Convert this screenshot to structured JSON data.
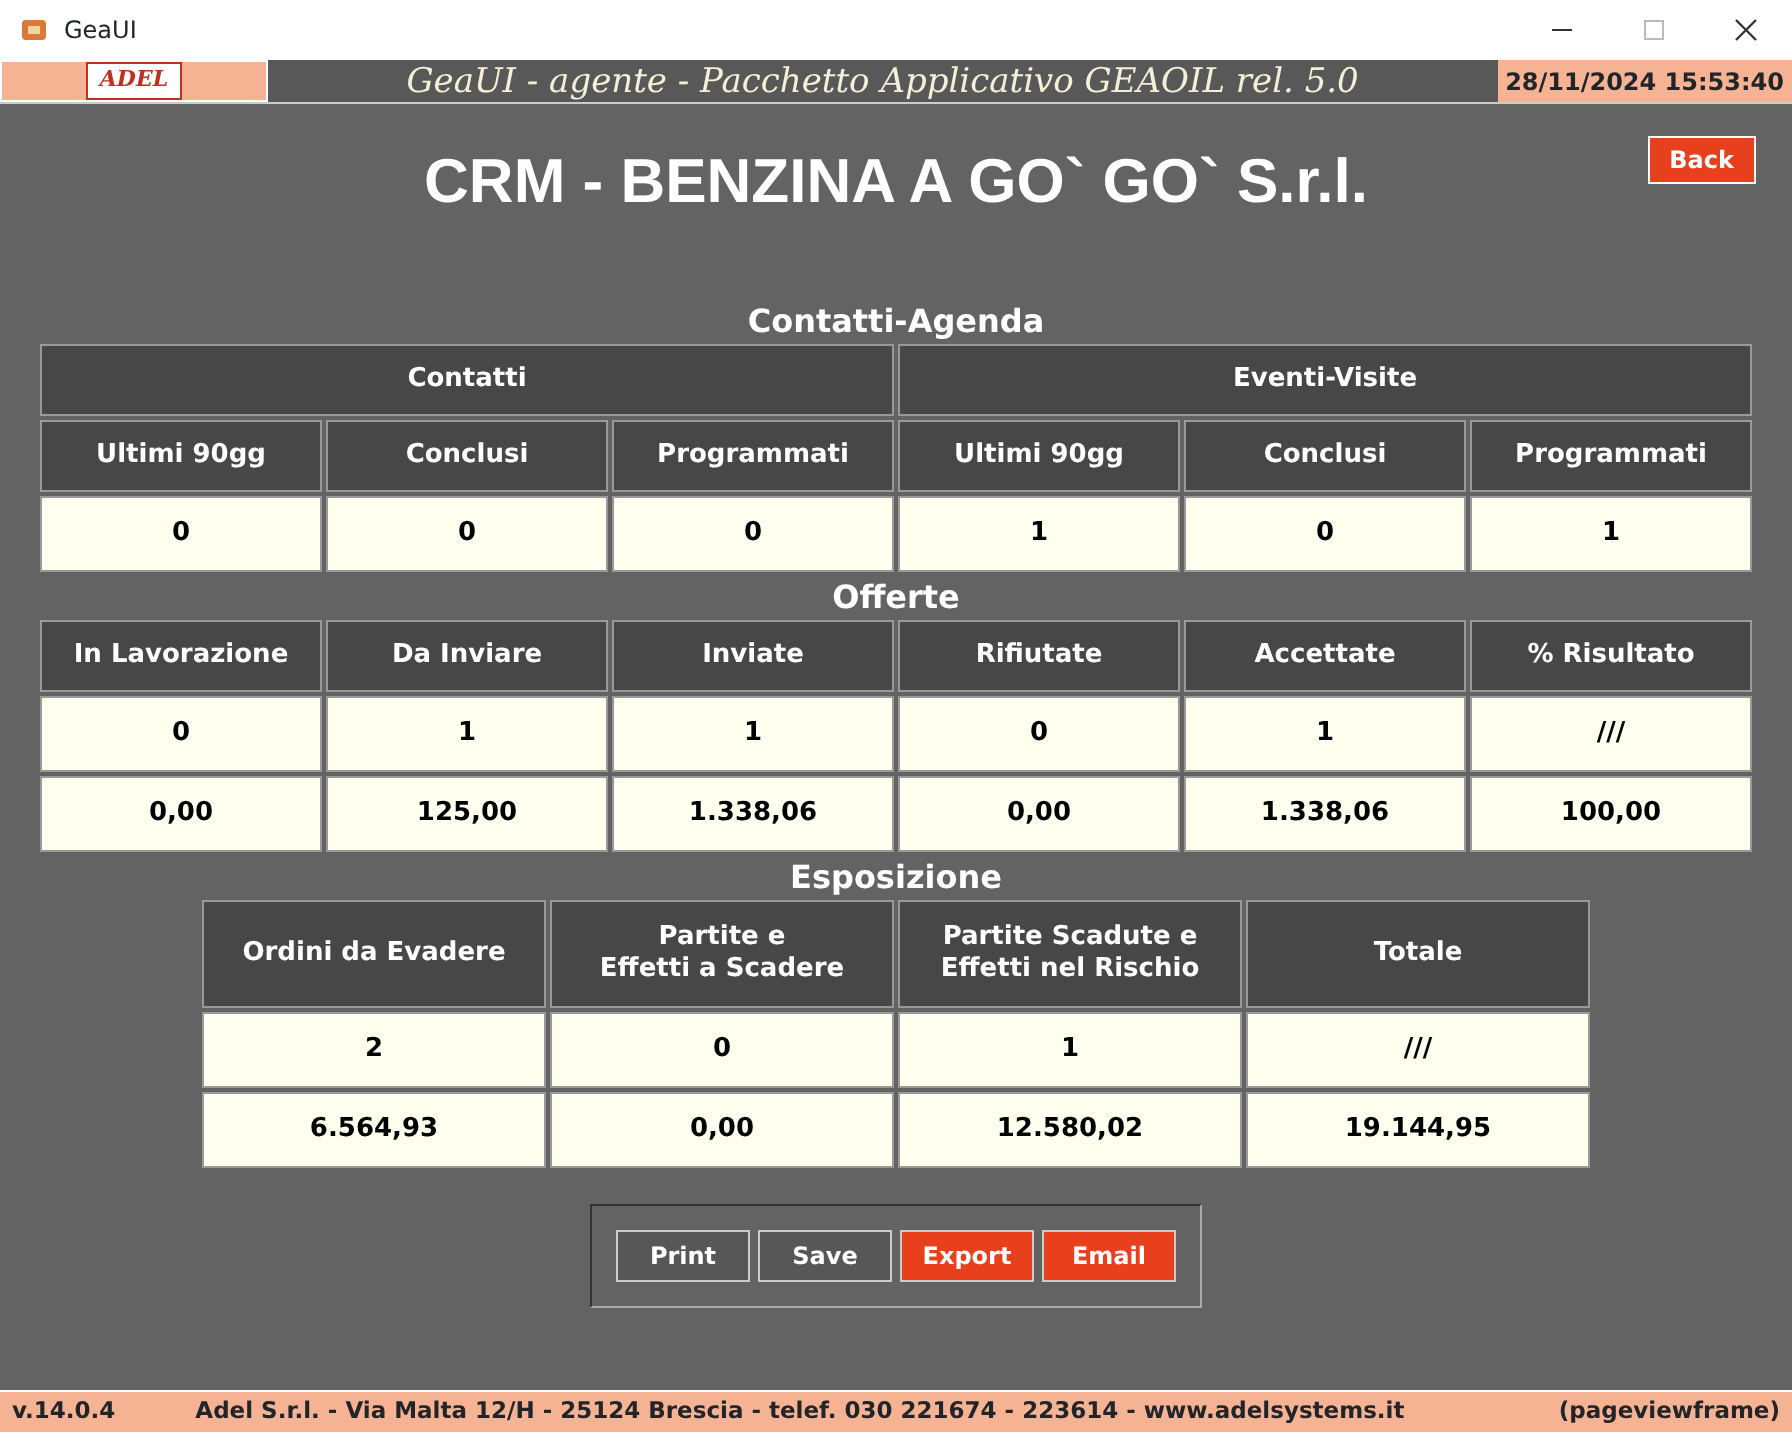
{
  "window": {
    "title": "GeaUI"
  },
  "header": {
    "logo": "ADEL",
    "title": "GeaUI - agente - Pacchetto Applicativo GEAOIL rel. 5.0",
    "datetime": "28/11/2024 15:53:40"
  },
  "page_title": "CRM - BENZINA A GO` GO` S.r.l.",
  "back_button": "Back",
  "sections": [
    {
      "title": "Contatti-Agenda",
      "groups": [
        "Contatti",
        "Eventi-Visite"
      ],
      "columns": [
        "Ultimi 90gg",
        "Conclusi",
        "Programmati",
        "Ultimi 90gg",
        "Conclusi",
        "Programmati"
      ],
      "rows": [
        [
          "0",
          "0",
          "0",
          "1",
          "0",
          "1"
        ]
      ]
    },
    {
      "title": "Offerte",
      "columns": [
        "In Lavorazione",
        "Da Inviare",
        "Inviate",
        "Rifiutate",
        "Accettate",
        "% Risultato"
      ],
      "rows": [
        [
          "0",
          "1",
          "1",
          "0",
          "1",
          "///"
        ],
        [
          "0,00",
          "125,00",
          "1.338,06",
          "0,00",
          "1.338,06",
          "100,00"
        ]
      ]
    },
    {
      "title": "Esposizione",
      "columns": [
        "Ordini da Evadere",
        "Partite e\nEffetti a Scadere",
        "Partite Scadute e\nEffetti nel Rischio",
        "Totale"
      ],
      "rows": [
        [
          "2",
          "0",
          "1",
          "///"
        ],
        [
          "6.564,93",
          "0,00",
          "12.580,02",
          "19.144,95"
        ]
      ]
    }
  ],
  "buttons": [
    {
      "label": "Print",
      "kind": "normal"
    },
    {
      "label": "Save",
      "kind": "normal"
    },
    {
      "label": "Export",
      "kind": "accent"
    },
    {
      "label": "Email",
      "kind": "accent"
    }
  ],
  "status_bar": {
    "version": "v.14.0.4",
    "company": "Adel S.r.l. - Via Malta 12/H - 25124 Brescia - telef. 030 221674 - 223614 - www.adelsystems.it",
    "frame": "(pageviewframe)"
  }
}
